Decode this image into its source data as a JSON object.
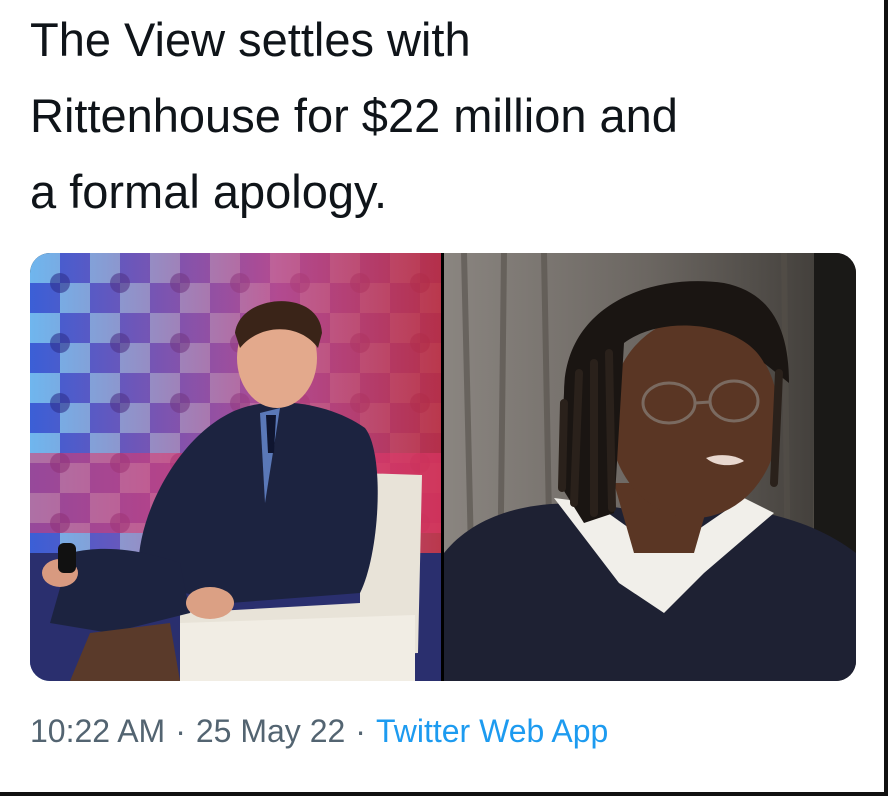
{
  "tweet": {
    "text_lines": [
      "The View settles with",
      "Rittenhouse for $22 million and",
      "a formal apology."
    ],
    "time": "10:22 AM",
    "date": "25 May 22",
    "separator": "·",
    "source": "Twitter Web App"
  },
  "colors": {
    "text": "#0f1419",
    "meta": "#536471",
    "link": "#1d9bf0"
  }
}
